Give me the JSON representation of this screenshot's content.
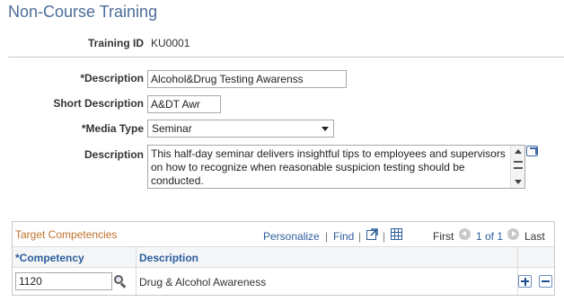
{
  "page_title": "Non-Course Training",
  "training": {
    "id_label": "Training ID",
    "id_value": "KU0001"
  },
  "form": {
    "description_label": "*Description",
    "description_value": "Alcohol&Drug Testing Awarenss",
    "short_description_label": "Short Description",
    "short_description_value": "A&DT Awr",
    "media_type_label": "*Media Type",
    "media_type_value": "Seminar",
    "long_description_label": "Description",
    "long_description_value": "This half-day seminar delivers insightful tips to employees and supervisors on how to recognize when reasonable suspicion testing should be conducted."
  },
  "competencies_grid": {
    "title": "Target Competencies",
    "personalize_label": "Personalize",
    "separator": "|",
    "find_label": "Find",
    "pager": {
      "first_label": "First",
      "position": "1 of 1",
      "last_label": "Last"
    },
    "columns": [
      "*Competency",
      "Description"
    ],
    "rows": [
      {
        "competency": "1120",
        "description": "Drug & Alcohol Awareness"
      }
    ]
  },
  "colors": {
    "title_blue": "#4c6c98",
    "link_blue": "#2d5e9c",
    "grid_title_orange": "#c0712a"
  },
  "icons": {
    "expand": "expand-text-icon",
    "spellcheck": "spellcheck-icon",
    "view_all": "view-all-icon",
    "download": "download-to-excel-icon",
    "lookup": "lookup-magnifier-icon",
    "add_row": "add-row-icon",
    "delete_row": "delete-row-icon"
  }
}
